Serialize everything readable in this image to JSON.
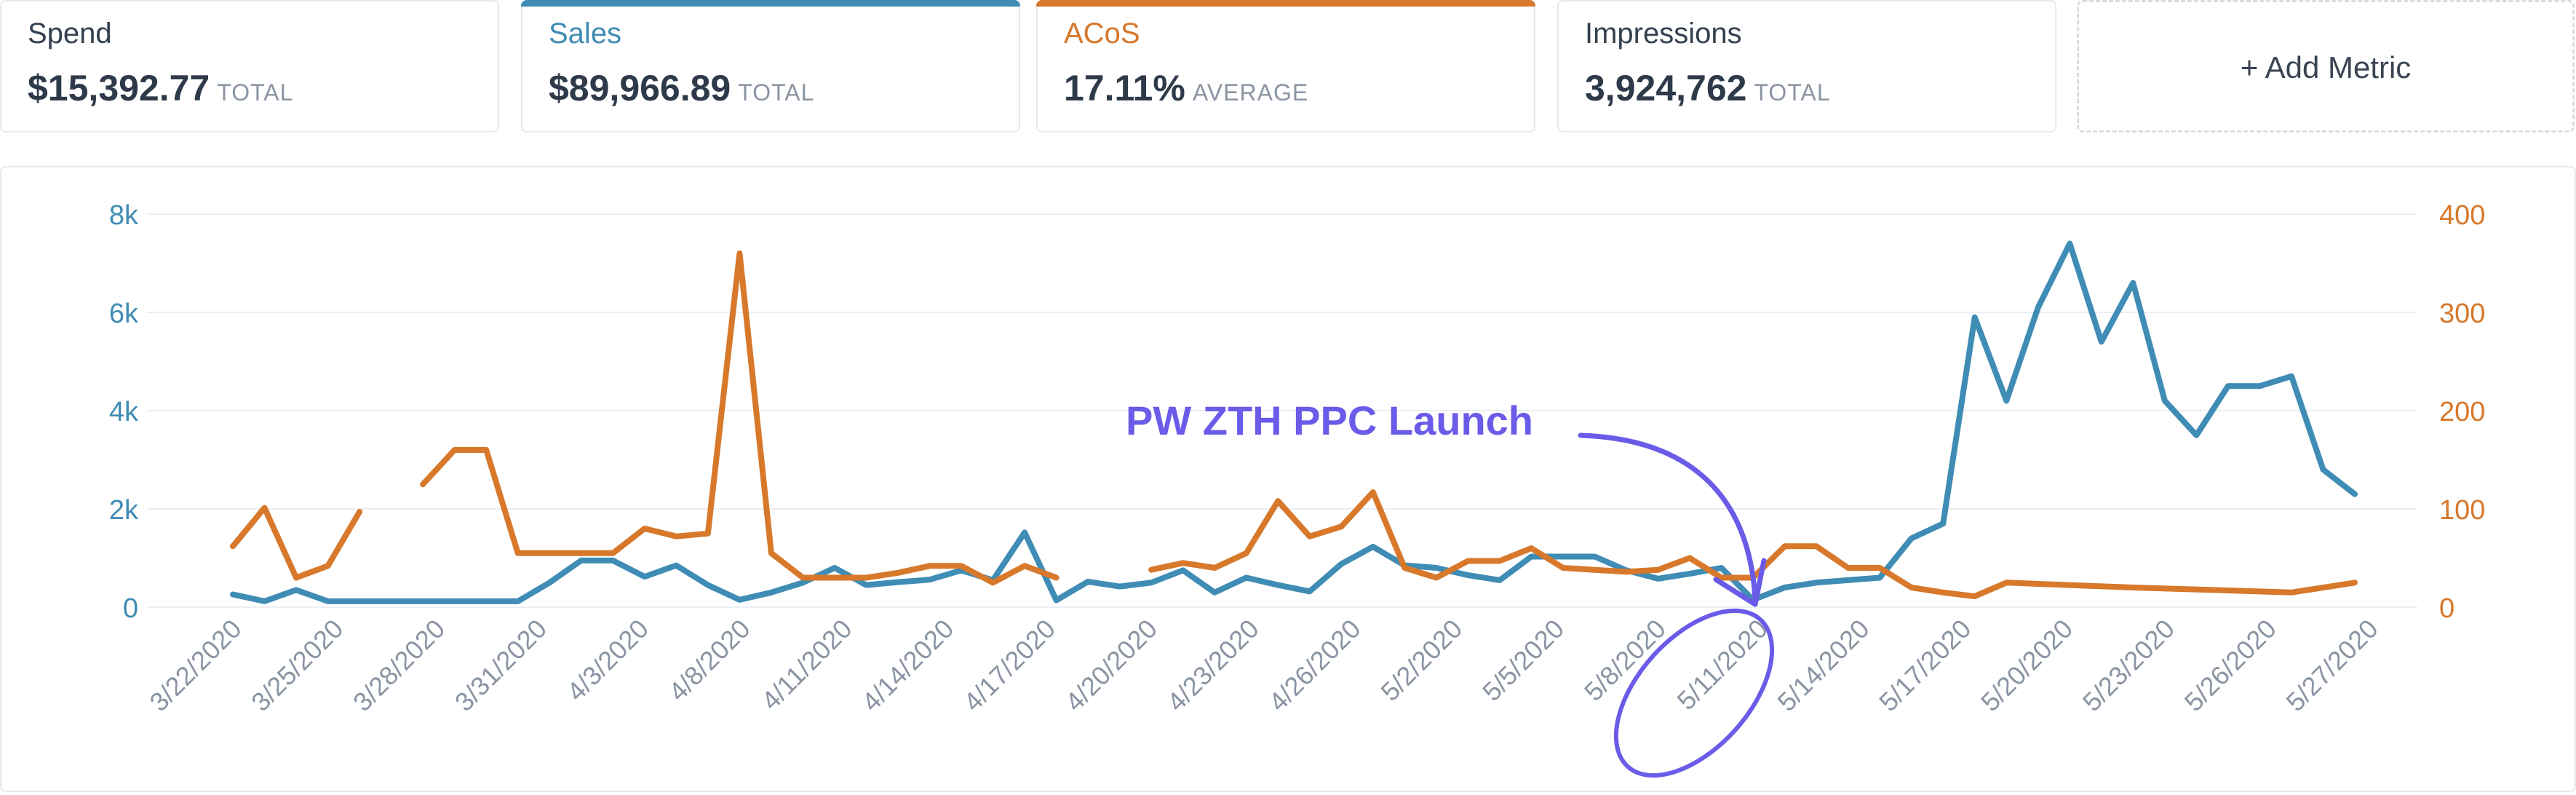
{
  "metrics": {
    "spend": {
      "label": "Spend",
      "value": "$15,392.77",
      "unit": "TOTAL"
    },
    "sales": {
      "label": "Sales",
      "value": "$89,966.89",
      "unit": "TOTAL",
      "color": "#3f8cb5"
    },
    "acos": {
      "label": "ACoS",
      "value": "17.11%",
      "unit": "AVERAGE",
      "color": "#d7782b"
    },
    "impressions": {
      "label": "Impressions",
      "value": "3,924,762",
      "unit": "TOTAL"
    },
    "add_metric": {
      "label": "+ Add Metric"
    }
  },
  "chart_data": {
    "type": "line",
    "x_ticks": [
      "3/22/2020",
      "3/25/2020",
      "3/28/2020",
      "3/31/2020",
      "4/3/2020",
      "4/8/2020",
      "4/11/2020",
      "4/14/2020",
      "4/17/2020",
      "4/20/2020",
      "4/23/2020",
      "4/26/2020",
      "5/2/2020",
      "5/5/2020",
      "5/8/2020",
      "5/11/2020",
      "5/14/2020",
      "5/17/2020",
      "5/20/2020",
      "5/23/2020",
      "5/26/2020",
      "5/27/2020"
    ],
    "y_left": {
      "ticks": [
        "0",
        "2k",
        "4k",
        "6k",
        "8k"
      ],
      "ylim": [
        0,
        8000
      ],
      "color": "#3f8cb5"
    },
    "y_right": {
      "ticks": [
        "0",
        "100",
        "200",
        "300",
        "400"
      ],
      "ylim": [
        0,
        400
      ],
      "color": "#d7782b"
    },
    "grid": true,
    "series": [
      {
        "name": "Sales",
        "axis": "left",
        "color": "#3f8cb5",
        "segments": [
          [
            [
              1,
              260
            ],
            [
              2,
              120
            ],
            [
              3,
              350
            ],
            [
              4,
              120
            ],
            [
              5,
              120
            ],
            [
              6,
              120
            ],
            [
              7,
              120
            ],
            [
              8,
              120
            ],
            [
              9,
              120
            ],
            [
              10,
              120
            ],
            [
              11,
              500
            ],
            [
              12,
              950
            ],
            [
              13,
              950
            ],
            [
              14,
              620
            ],
            [
              15,
              850
            ],
            [
              16,
              450
            ],
            [
              17,
              150
            ],
            [
              18,
              300
            ],
            [
              19,
              500
            ],
            [
              20,
              800
            ],
            [
              21,
              450
            ],
            [
              22,
              510
            ],
            [
              23,
              560
            ],
            [
              24,
              750
            ],
            [
              25,
              550
            ],
            [
              26,
              1520
            ],
            [
              27,
              140
            ],
            [
              28,
              520
            ],
            [
              29,
              420
            ],
            [
              30,
              500
            ],
            [
              31,
              750
            ],
            [
              32,
              300
            ],
            [
              33,
              600
            ],
            [
              34,
              450
            ],
            [
              35,
              320
            ],
            [
              36,
              880
            ],
            [
              37,
              1230
            ],
            [
              38,
              850
            ],
            [
              39,
              800
            ],
            [
              40,
              650
            ],
            [
              41,
              550
            ],
            [
              42,
              1030
            ],
            [
              43,
              1030
            ],
            [
              44,
              1030
            ],
            [
              45,
              750
            ],
            [
              46,
              580
            ],
            [
              47,
              680
            ],
            [
              48,
              800
            ],
            [
              49,
              150
            ],
            [
              50,
              400
            ],
            [
              51,
              500
            ],
            [
              52,
              550
            ],
            [
              53,
              600
            ],
            [
              54,
              1400
            ],
            [
              55,
              1700
            ],
            [
              56,
              5900
            ],
            [
              57,
              4200
            ],
            [
              58,
              6100
            ],
            [
              59,
              7400
            ],
            [
              60,
              5400
            ],
            [
              61,
              6600
            ],
            [
              62,
              4200
            ],
            [
              63,
              3500
            ],
            [
              64,
              4500
            ],
            [
              65,
              4500
            ],
            [
              66,
              4700
            ],
            [
              67,
              2800
            ],
            [
              68,
              2300
            ]
          ]
        ]
      },
      {
        "name": "ACoS",
        "axis": "right",
        "color": "#d7782b",
        "segments": [
          [
            [
              1,
              62
            ],
            [
              2,
              101
            ],
            [
              3,
              30
            ],
            [
              4,
              42
            ],
            [
              5,
              97
            ]
          ],
          [
            [
              7,
              125
            ],
            [
              8,
              160
            ],
            [
              9,
              160
            ],
            [
              10,
              55
            ],
            [
              11,
              55
            ],
            [
              12,
              55
            ],
            [
              13,
              55
            ],
            [
              14,
              80
            ],
            [
              15,
              72
            ],
            [
              16,
              75
            ],
            [
              17,
              360
            ],
            [
              18,
              55
            ],
            [
              19,
              30
            ],
            [
              20,
              30
            ],
            [
              21,
              30
            ],
            [
              22,
              35
            ],
            [
              23,
              42
            ],
            [
              24,
              42
            ],
            [
              25,
              25
            ],
            [
              26,
              42
            ],
            [
              27,
              30
            ]
          ],
          [
            [
              30,
              38
            ],
            [
              31,
              45
            ],
            [
              32,
              40
            ],
            [
              33,
              55
            ],
            [
              34,
              108
            ],
            [
              35,
              72
            ],
            [
              36,
              82
            ],
            [
              37,
              117
            ],
            [
              38,
              40
            ],
            [
              39,
              30
            ],
            [
              40,
              47
            ],
            [
              41,
              47
            ],
            [
              42,
              60
            ],
            [
              43,
              40
            ],
            [
              44,
              38
            ],
            [
              45,
              36
            ],
            [
              46,
              38
            ],
            [
              47,
              50
            ],
            [
              48,
              30
            ],
            [
              49,
              30
            ],
            [
              50,
              62
            ],
            [
              51,
              62
            ],
            [
              52,
              40
            ],
            [
              53,
              40
            ],
            [
              54,
              20
            ],
            [
              55,
              15
            ],
            [
              56,
              11
            ],
            [
              57,
              25
            ],
            [
              61,
              20
            ],
            [
              66,
              15
            ],
            [
              68,
              25
            ]
          ]
        ]
      }
    ],
    "annotation": "PW ZTH PPC Launch"
  }
}
